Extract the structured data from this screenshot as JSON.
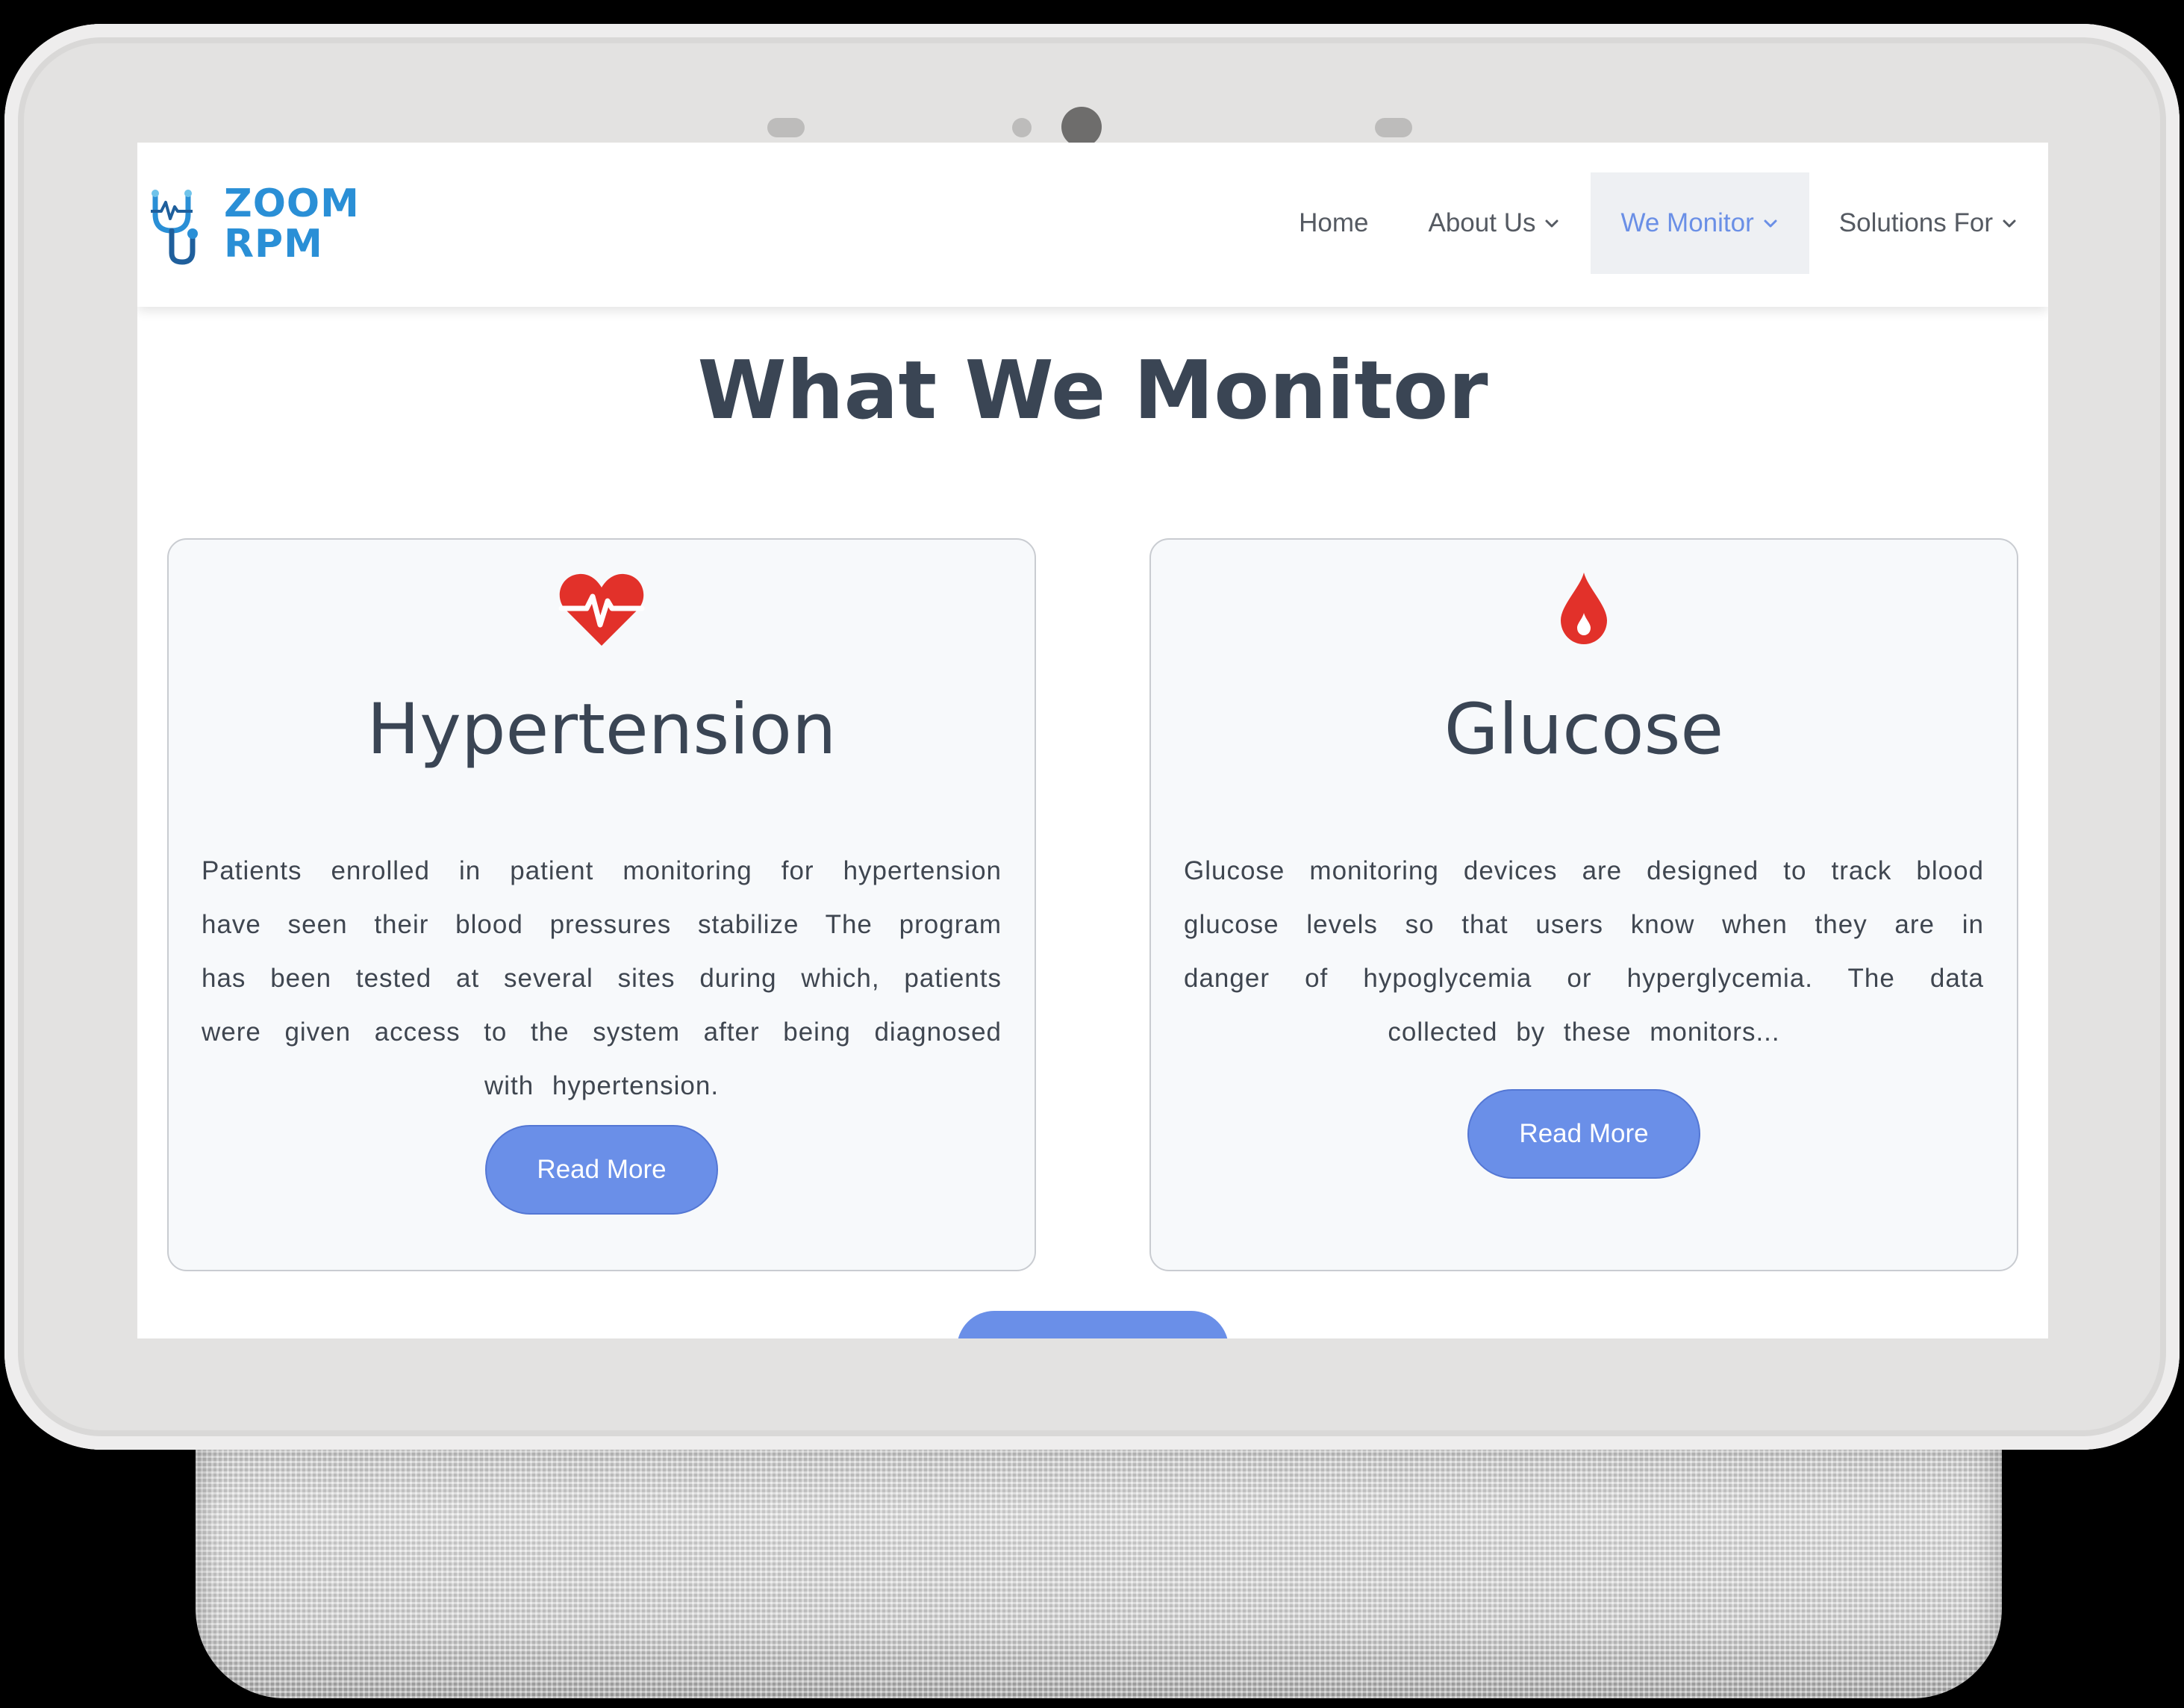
{
  "colors": {
    "accent": "#6a8fe8",
    "heading": "#3a4554",
    "icon_red": "#e2312a",
    "logo_blue": "#2a8fd6",
    "nav_active": "#6a8fe6"
  },
  "logo": {
    "line1": "ZOOM",
    "line2": "RPM",
    "icon": "stethoscope-heartbeat-icon"
  },
  "nav": {
    "items": [
      {
        "label": "Home",
        "has_dropdown": false
      },
      {
        "label": "About Us",
        "has_dropdown": true
      },
      {
        "label": "We Monitor",
        "has_dropdown": true,
        "active": true
      },
      {
        "label": "Solutions For",
        "has_dropdown": true
      }
    ]
  },
  "page": {
    "title": "What We Monitor"
  },
  "cards": [
    {
      "icon": "heart-pulse-icon",
      "title": "Hypertension",
      "body": "Patients enrolled in patient monitoring for hypertension have seen their blood pressures stabilize The program has been tested at several sites during which, patients were given access to the system after being diagnosed with hypertension.",
      "button": "Read More"
    },
    {
      "icon": "blood-drop-icon",
      "title": "Glucose",
      "body": "Glucose monitoring devices are designed to track blood glucose levels so that users know when they are in danger of hypoglycemia or hyperglycemia. The data collected by these monitors...",
      "button": "Read More"
    }
  ]
}
